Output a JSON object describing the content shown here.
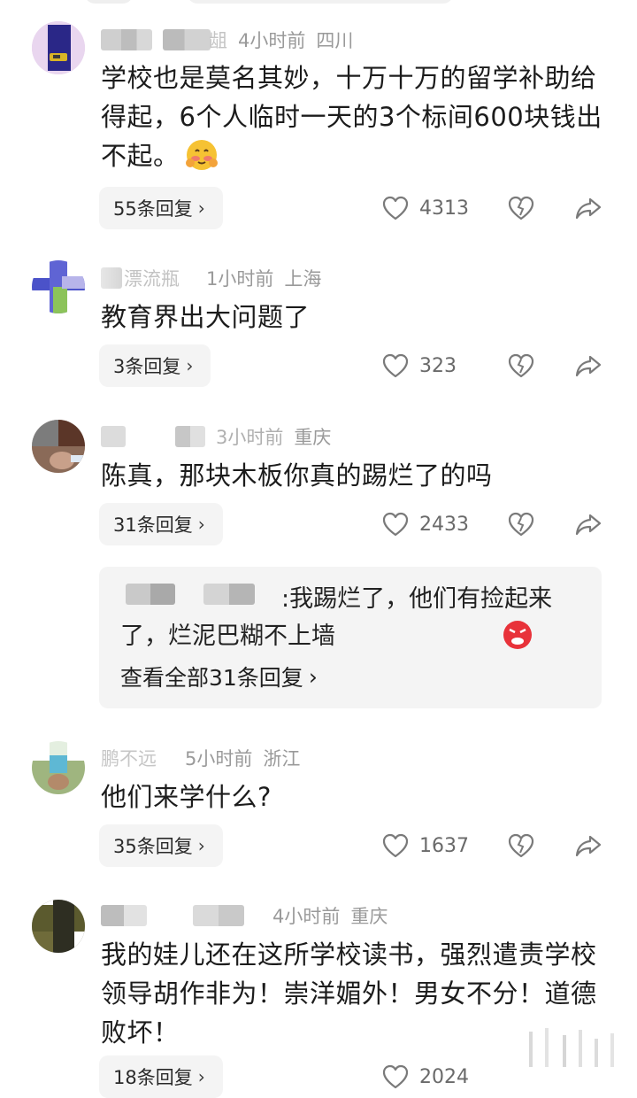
{
  "comments": [
    {
      "time": "4小时前",
      "location": "四川",
      "name_fragment": "龃",
      "text": "学校也是莫名其妙，十万十万的留学补助给得起，6个人临时一天的3个标间600块钱出不起。",
      "reply_label": "55条回复",
      "likes": "4313"
    },
    {
      "time": "1小时前",
      "location": "上海",
      "name_fragment": "漂流瓶",
      "text": "教育界出大问题了",
      "reply_label": "3条回复",
      "likes": "323"
    },
    {
      "time": "3小时前",
      "location": "重庆",
      "text": "陈真，那块木板你真的踢烂了的吗",
      "reply_label": "31条回复",
      "likes": "2433",
      "preview": {
        "text": ":我踢烂了，他们有捡起来了，烂泥巴糊不上墙",
        "view_all": "查看全部31条回复"
      }
    },
    {
      "time": "5小时前",
      "location": "浙江",
      "name_fragment": "鹏不远",
      "text": "他们来学什么?",
      "reply_label": "35条回复",
      "likes": "1637"
    },
    {
      "time": "4小时前",
      "location": "重庆",
      "text": "我的娃儿还在这所学校读书，强烈遣责学校领导胡作非为！崇洋媚外！男女不分！道德败坏！",
      "reply_label": "18条回复",
      "likes": "2024"
    }
  ],
  "icons": {
    "like": "heart-outline-icon",
    "dislike": "broken-heart-icon",
    "share": "share-arrow-icon",
    "chevron": "chevron-right-icon"
  },
  "chevron_glyph": "›",
  "colors": {
    "meta": "#9a9a9a",
    "pill": "#f4f4f4",
    "icon": "#8a8a8a"
  }
}
